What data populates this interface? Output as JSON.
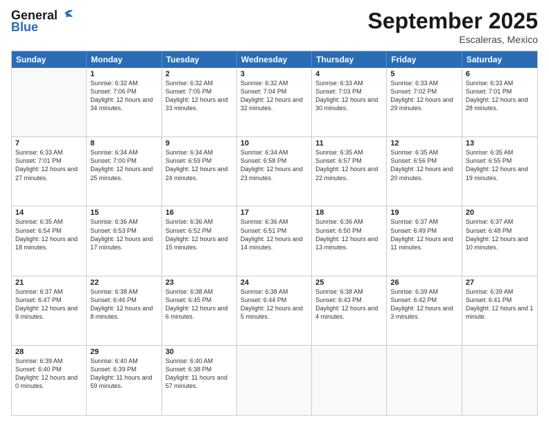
{
  "logo": {
    "line1": "General",
    "line2": "Blue"
  },
  "title": "September 2025",
  "subtitle": "Escaleras, Mexico",
  "header_days": [
    "Sunday",
    "Monday",
    "Tuesday",
    "Wednesday",
    "Thursday",
    "Friday",
    "Saturday"
  ],
  "weeks": [
    [
      {
        "day": "",
        "empty": true
      },
      {
        "day": "1",
        "sunrise": "Sunrise: 6:32 AM",
        "sunset": "Sunset: 7:06 PM",
        "daylight": "Daylight: 12 hours and 34 minutes."
      },
      {
        "day": "2",
        "sunrise": "Sunrise: 6:32 AM",
        "sunset": "Sunset: 7:05 PM",
        "daylight": "Daylight: 12 hours and 33 minutes."
      },
      {
        "day": "3",
        "sunrise": "Sunrise: 6:32 AM",
        "sunset": "Sunset: 7:04 PM",
        "daylight": "Daylight: 12 hours and 32 minutes."
      },
      {
        "day": "4",
        "sunrise": "Sunrise: 6:33 AM",
        "sunset": "Sunset: 7:03 PM",
        "daylight": "Daylight: 12 hours and 30 minutes."
      },
      {
        "day": "5",
        "sunrise": "Sunrise: 6:33 AM",
        "sunset": "Sunset: 7:02 PM",
        "daylight": "Daylight: 12 hours and 29 minutes."
      },
      {
        "day": "6",
        "sunrise": "Sunrise: 6:33 AM",
        "sunset": "Sunset: 7:01 PM",
        "daylight": "Daylight: 12 hours and 28 minutes."
      }
    ],
    [
      {
        "day": "7",
        "sunrise": "Sunrise: 6:33 AM",
        "sunset": "Sunset: 7:01 PM",
        "daylight": "Daylight: 12 hours and 27 minutes."
      },
      {
        "day": "8",
        "sunrise": "Sunrise: 6:34 AM",
        "sunset": "Sunset: 7:00 PM",
        "daylight": "Daylight: 12 hours and 25 minutes."
      },
      {
        "day": "9",
        "sunrise": "Sunrise: 6:34 AM",
        "sunset": "Sunset: 6:59 PM",
        "daylight": "Daylight: 12 hours and 24 minutes."
      },
      {
        "day": "10",
        "sunrise": "Sunrise: 6:34 AM",
        "sunset": "Sunset: 6:58 PM",
        "daylight": "Daylight: 12 hours and 23 minutes."
      },
      {
        "day": "11",
        "sunrise": "Sunrise: 6:35 AM",
        "sunset": "Sunset: 6:57 PM",
        "daylight": "Daylight: 12 hours and 22 minutes."
      },
      {
        "day": "12",
        "sunrise": "Sunrise: 6:35 AM",
        "sunset": "Sunset: 6:56 PM",
        "daylight": "Daylight: 12 hours and 20 minutes."
      },
      {
        "day": "13",
        "sunrise": "Sunrise: 6:35 AM",
        "sunset": "Sunset: 6:55 PM",
        "daylight": "Daylight: 12 hours and 19 minutes."
      }
    ],
    [
      {
        "day": "14",
        "sunrise": "Sunrise: 6:35 AM",
        "sunset": "Sunset: 6:54 PM",
        "daylight": "Daylight: 12 hours and 18 minutes."
      },
      {
        "day": "15",
        "sunrise": "Sunrise: 6:36 AM",
        "sunset": "Sunset: 6:53 PM",
        "daylight": "Daylight: 12 hours and 17 minutes."
      },
      {
        "day": "16",
        "sunrise": "Sunrise: 6:36 AM",
        "sunset": "Sunset: 6:52 PM",
        "daylight": "Daylight: 12 hours and 15 minutes."
      },
      {
        "day": "17",
        "sunrise": "Sunrise: 6:36 AM",
        "sunset": "Sunset: 6:51 PM",
        "daylight": "Daylight: 12 hours and 14 minutes."
      },
      {
        "day": "18",
        "sunrise": "Sunrise: 6:36 AM",
        "sunset": "Sunset: 6:50 PM",
        "daylight": "Daylight: 12 hours and 13 minutes."
      },
      {
        "day": "19",
        "sunrise": "Sunrise: 6:37 AM",
        "sunset": "Sunset: 6:49 PM",
        "daylight": "Daylight: 12 hours and 11 minutes."
      },
      {
        "day": "20",
        "sunrise": "Sunrise: 6:37 AM",
        "sunset": "Sunset: 6:48 PM",
        "daylight": "Daylight: 12 hours and 10 minutes."
      }
    ],
    [
      {
        "day": "21",
        "sunrise": "Sunrise: 6:37 AM",
        "sunset": "Sunset: 6:47 PM",
        "daylight": "Daylight: 12 hours and 9 minutes."
      },
      {
        "day": "22",
        "sunrise": "Sunrise: 6:38 AM",
        "sunset": "Sunset: 6:46 PM",
        "daylight": "Daylight: 12 hours and 8 minutes."
      },
      {
        "day": "23",
        "sunrise": "Sunrise: 6:38 AM",
        "sunset": "Sunset: 6:45 PM",
        "daylight": "Daylight: 12 hours and 6 minutes."
      },
      {
        "day": "24",
        "sunrise": "Sunrise: 6:38 AM",
        "sunset": "Sunset: 6:44 PM",
        "daylight": "Daylight: 12 hours and 5 minutes."
      },
      {
        "day": "25",
        "sunrise": "Sunrise: 6:38 AM",
        "sunset": "Sunset: 6:43 PM",
        "daylight": "Daylight: 12 hours and 4 minutes."
      },
      {
        "day": "26",
        "sunrise": "Sunrise: 6:39 AM",
        "sunset": "Sunset: 6:42 PM",
        "daylight": "Daylight: 12 hours and 3 minutes."
      },
      {
        "day": "27",
        "sunrise": "Sunrise: 6:39 AM",
        "sunset": "Sunset: 6:41 PM",
        "daylight": "Daylight: 12 hours and 1 minute."
      }
    ],
    [
      {
        "day": "28",
        "sunrise": "Sunrise: 6:39 AM",
        "sunset": "Sunset: 6:40 PM",
        "daylight": "Daylight: 12 hours and 0 minutes."
      },
      {
        "day": "29",
        "sunrise": "Sunrise: 6:40 AM",
        "sunset": "Sunset: 6:39 PM",
        "daylight": "Daylight: 11 hours and 59 minutes."
      },
      {
        "day": "30",
        "sunrise": "Sunrise: 6:40 AM",
        "sunset": "Sunset: 6:38 PM",
        "daylight": "Daylight: 11 hours and 57 minutes."
      },
      {
        "day": "",
        "empty": true
      },
      {
        "day": "",
        "empty": true
      },
      {
        "day": "",
        "empty": true
      },
      {
        "day": "",
        "empty": true
      }
    ]
  ]
}
